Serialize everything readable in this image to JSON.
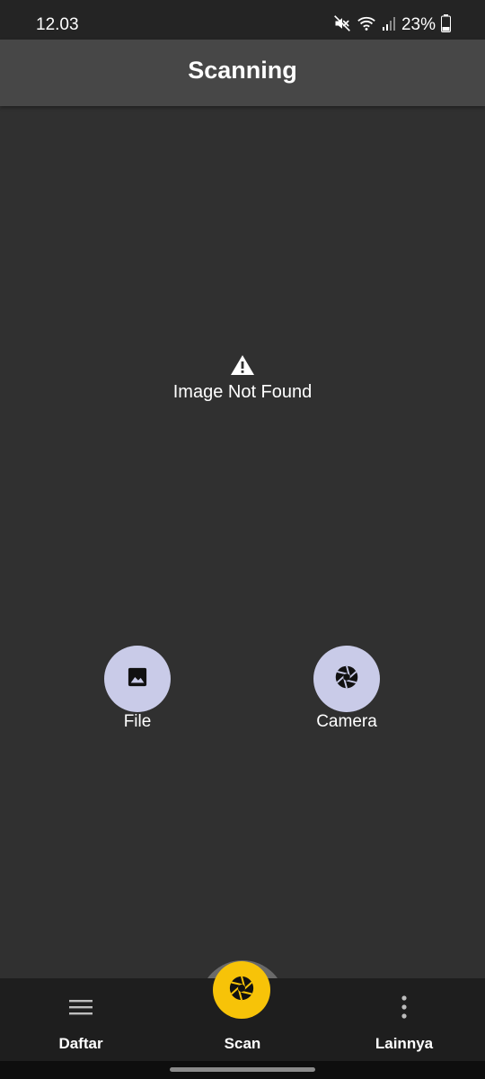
{
  "status_bar": {
    "time": "12.03",
    "battery_text": "23%",
    "icons": [
      "mute-icon",
      "wifi-icon",
      "signal-icon",
      "battery-icon"
    ]
  },
  "app_bar": {
    "title": "Scanning"
  },
  "empty_state": {
    "icon": "warning-icon",
    "message": "Image Not Found"
  },
  "actions": {
    "file": {
      "label": "File",
      "icon": "image-icon"
    },
    "camera": {
      "label": "Camera",
      "icon": "aperture-icon"
    }
  },
  "bottom_nav": {
    "items": [
      {
        "label": "Daftar",
        "icon": "menu-icon"
      },
      {
        "label": "Scan",
        "icon": "aperture-icon"
      },
      {
        "label": "Lainnya",
        "icon": "more-vertical-icon"
      }
    ]
  },
  "colors": {
    "background": "#303030",
    "app_bar": "#474747",
    "status_bar": "#242424",
    "bottom_nav": "#1e1e1e",
    "action_circle": "#c9cbe8",
    "scan_accent": "#f7c308"
  }
}
